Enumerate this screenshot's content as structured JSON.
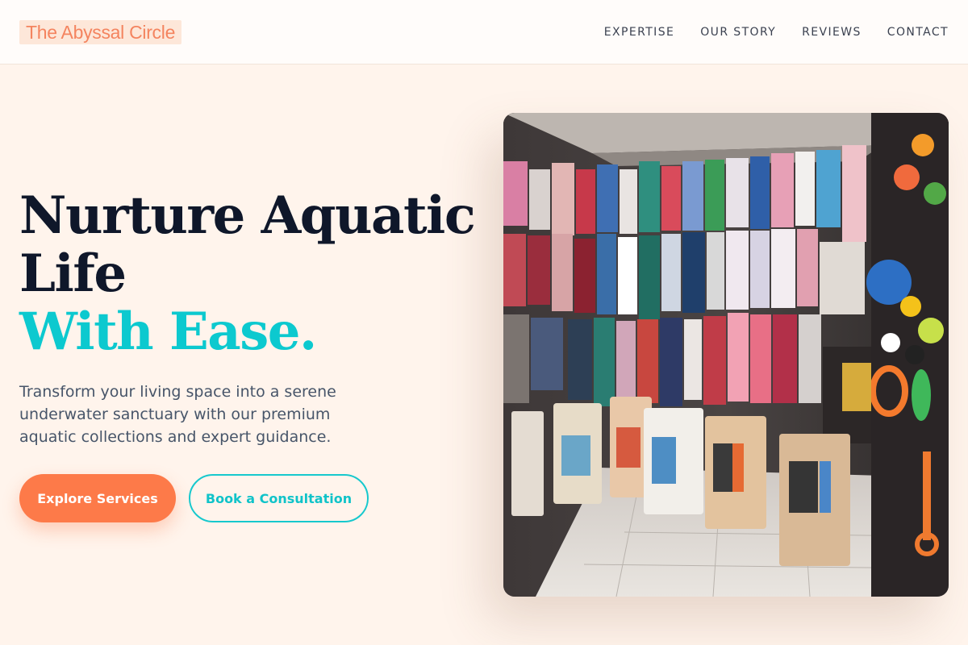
{
  "header": {
    "logo": "The Abyssal Circle",
    "nav": [
      "EXPERTISE",
      "OUR STORY",
      "REVIEWS",
      "CONTACT"
    ]
  },
  "hero": {
    "headline_line1": "Nurture Aquatic",
    "headline_line2": "Life",
    "headline_accent": "With Ease.",
    "subtitle": "Transform your living space into a serene underwater sanctuary with our premium aquatic collections and expert guidance.",
    "primary_button": "Explore Services",
    "secondary_button": "Book a Consultation"
  },
  "colors": {
    "accent_orange": "#fd7a49",
    "accent_teal": "#0cc9cf",
    "background": "#fff4ec",
    "heading": "#0f172a"
  }
}
